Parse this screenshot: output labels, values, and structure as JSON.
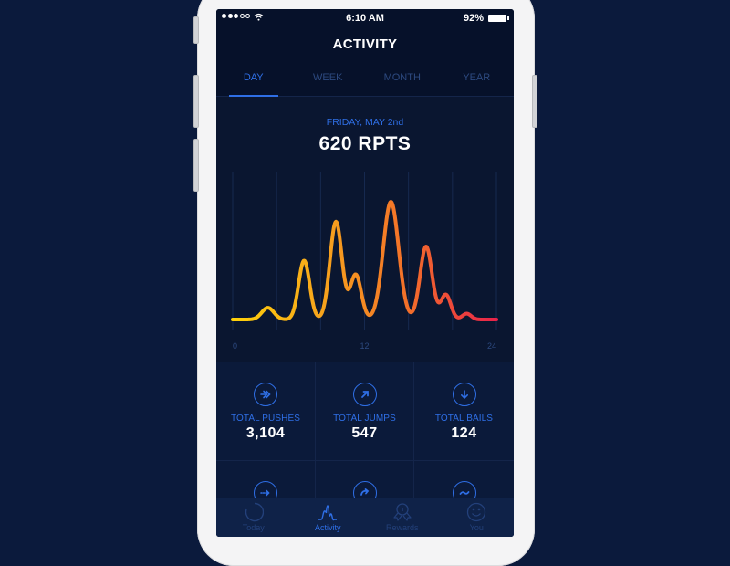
{
  "status_bar": {
    "signal_bars_filled": 3,
    "signal_bars_total": 5,
    "time": "6:10 AM",
    "battery_percent": "92%"
  },
  "header": {
    "title": "ACTIVITY"
  },
  "period_tabs": [
    {
      "label": "DAY",
      "active": true
    },
    {
      "label": "WEEK",
      "active": false
    },
    {
      "label": "MONTH",
      "active": false
    },
    {
      "label": "YEAR",
      "active": false
    }
  ],
  "summary": {
    "date": "FRIDAY, MAY 2nd",
    "total": "620 RPTS"
  },
  "chart_data": {
    "type": "line",
    "title": "",
    "xlabel": "",
    "ylabel": "",
    "x_tick_labels": [
      "0",
      "12",
      "24"
    ],
    "xlim": [
      0,
      24
    ],
    "ylim": [
      0,
      100
    ],
    "grid": "vertical",
    "gradient_colors": [
      "#ffd10a",
      "#f7a51c",
      "#f36f2a",
      "#e8234a"
    ],
    "peaks": [
      {
        "hour": 3.2,
        "value": 10,
        "width": 0.55
      },
      {
        "hour": 6.5,
        "value": 50,
        "width": 0.5
      },
      {
        "hour": 9.4,
        "value": 83,
        "width": 0.55
      },
      {
        "hour": 11.2,
        "value": 38,
        "width": 0.5
      },
      {
        "hour": 14.4,
        "value": 100,
        "width": 0.7
      },
      {
        "hour": 17.6,
        "value": 62,
        "width": 0.55
      },
      {
        "hour": 19.4,
        "value": 21,
        "width": 0.45
      },
      {
        "hour": 21.3,
        "value": 5,
        "width": 0.4
      }
    ]
  },
  "stats": [
    {
      "icon": "double-chevron-right-icon",
      "label": "TOTAL PUSHES",
      "value": "3,104"
    },
    {
      "icon": "arrow-up-right-icon",
      "label": "TOTAL JUMPS",
      "value": "547"
    },
    {
      "icon": "arrow-down-icon",
      "label": "TOTAL BAILS",
      "value": "124"
    },
    {
      "icon": "dotted-arrow-right-icon",
      "label": "",
      "value": ""
    },
    {
      "icon": "rotate-arrow-icon",
      "label": "",
      "value": ""
    },
    {
      "icon": "wave-icon",
      "label": "",
      "value": ""
    }
  ],
  "tab_bar": [
    {
      "label": "Today",
      "icon": "progress-ring-icon",
      "active": false
    },
    {
      "label": "Activity",
      "icon": "activity-wave-icon",
      "active": true
    },
    {
      "label": "Rewards",
      "icon": "award-ribbon-icon",
      "active": false
    },
    {
      "label": "You",
      "icon": "smiley-face-icon",
      "active": false
    }
  ],
  "colors": {
    "accent": "#2f6fe6",
    "background": "#0a1630",
    "inactive": "#2d4a80"
  }
}
